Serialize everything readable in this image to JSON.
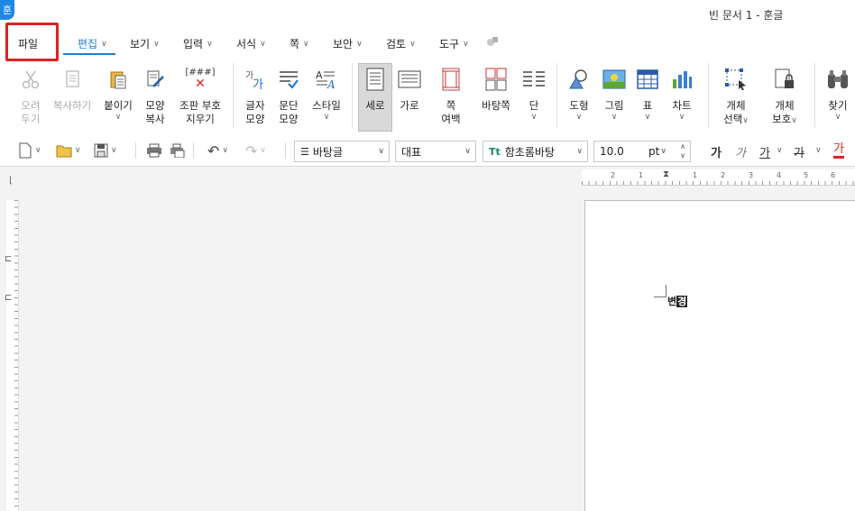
{
  "app": {
    "badge": "훈",
    "title": "빈 문서 1 - 훈글"
  },
  "menu": {
    "file": "파일",
    "tabs": [
      {
        "label": "편집",
        "active": true
      },
      {
        "label": "보기"
      },
      {
        "label": "입력"
      },
      {
        "label": "서식"
      },
      {
        "label": "쪽"
      },
      {
        "label": "보안"
      },
      {
        "label": "검토"
      },
      {
        "label": "도구"
      }
    ]
  },
  "ribbon": {
    "cut": [
      "오려",
      "두기"
    ],
    "copy": "복사하기",
    "paste": "붙이기",
    "format_copy": [
      "모양",
      "복사"
    ],
    "clear_codes": [
      "조판 부호",
      "지우기"
    ],
    "clear_codes_icon_text": "[###]",
    "char_shape": [
      "글자",
      "모양"
    ],
    "para_shape": [
      "문단",
      "모양"
    ],
    "style": "스타일",
    "portrait": "세로",
    "landscape": "가로",
    "page_margin": [
      "쪽",
      "여백"
    ],
    "background": "바탕쪽",
    "columns": "단",
    "shape": "도형",
    "picture": "그림",
    "table": "표",
    "chart": "차트",
    "object_select": [
      "개체",
      "선택"
    ],
    "object_protect": [
      "개체",
      "보호"
    ],
    "find": "찾기"
  },
  "toolbar": {
    "style_name": "바탕글",
    "lang": "대표",
    "font": "함초롬바탕",
    "font_icon": "Tt",
    "size": "10.0",
    "unit": "pt",
    "bold": "가",
    "italic": "가",
    "underline": "가",
    "strike": "가",
    "color_text": "가"
  },
  "ruler": {
    "h_marks": [
      "2",
      "1",
      "1",
      "2",
      "3",
      "4",
      "5",
      "6"
    ]
  },
  "document": {
    "caret_text_a": "변",
    "caret_text_b": "경"
  },
  "colors": {
    "accent": "#1a7fd4",
    "highlight": "#e02020"
  }
}
